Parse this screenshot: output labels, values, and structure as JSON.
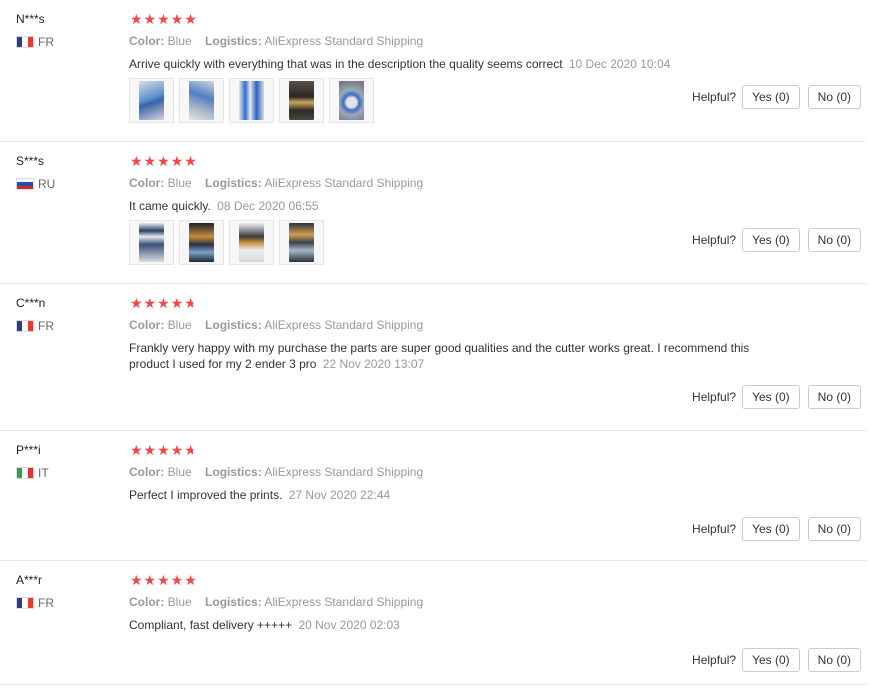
{
  "reviews": [
    {
      "user": "N***s",
      "country": "FR",
      "flag": [
        "#2f3a8f",
        "#ffffff",
        "#e53935"
      ],
      "flag_orientation": "vertical",
      "rating": 5,
      "color_label": "Color:",
      "color": "Blue",
      "logistics_label": "Logistics:",
      "logistics": "AliExpress Standard Shipping",
      "text": "Arrive quickly with everything that was in the description the quality seems correct",
      "date": "10 Dec 2020 10:04",
      "images": [
        "photo-blue-cable-coil",
        "photo-blue-cable-bag",
        "photo-blue-tubing-pair",
        "photo-hotend-parts",
        "photo-blue-cable-roll"
      ],
      "helpful_label": "Helpful?",
      "yes_label": "Yes (0)",
      "no_label": "No (0)"
    },
    {
      "user": "S***s",
      "country": "RU",
      "flag": [
        "#ffffff",
        "#1e50b4",
        "#d52b1e"
      ],
      "flag_orientation": "horizontal",
      "rating": 5,
      "color_label": "Color:",
      "color": "Blue",
      "logistics_label": "Logistics:",
      "logistics": "AliExpress Standard Shipping",
      "text": "It came quickly.",
      "date": "08 Dec 2020 06:55",
      "images": [
        "photo-parts-on-white",
        "photo-nozzles-dark",
        "photo-nozzles-light",
        "photo-fittings-dark"
      ],
      "helpful_label": "Helpful?",
      "yes_label": "Yes (0)",
      "no_label": "No (0)"
    },
    {
      "user": "C***n",
      "country": "FR",
      "flag": [
        "#2f3a8f",
        "#ffffff",
        "#e53935"
      ],
      "flag_orientation": "vertical",
      "rating": 4.5,
      "color_label": "Color:",
      "color": "Blue",
      "logistics_label": "Logistics:",
      "logistics": "AliExpress Standard Shipping",
      "text": "Frankly very happy with my purchase the parts are super good qualities and the cutter works great. I recommend this product I used for my 2 ender 3 pro",
      "date": "22 Nov 2020 13:07",
      "images": [],
      "helpful_label": "Helpful?",
      "yes_label": "Yes (0)",
      "no_label": "No (0)"
    },
    {
      "user": "P***i",
      "country": "IT",
      "flag": [
        "#2e9e4f",
        "#ffffff",
        "#d9343a"
      ],
      "flag_orientation": "vertical",
      "rating": 4.5,
      "color_label": "Color:",
      "color": "Blue",
      "logistics_label": "Logistics:",
      "logistics": "AliExpress Standard Shipping",
      "text": "Perfect I improved the prints.",
      "date": "27 Nov 2020 22:44",
      "images": [],
      "helpful_label": "Helpful?",
      "yes_label": "Yes (0)",
      "no_label": "No (0)"
    },
    {
      "user": "A***r",
      "country": "FR",
      "flag": [
        "#2f3a8f",
        "#ffffff",
        "#e53935"
      ],
      "flag_orientation": "vertical",
      "rating": 5,
      "color_label": "Color:",
      "color": "Blue",
      "logistics_label": "Logistics:",
      "logistics": "AliExpress Standard Shipping",
      "text": "Compliant, fast delivery +++++",
      "date": "20 Nov 2020 02:03",
      "images": [],
      "helpful_label": "Helpful?",
      "yes_label": "Yes (0)",
      "no_label": "No (0)"
    }
  ],
  "colors": {
    "star": "#f04848",
    "muted_text": "#999999",
    "divider": "#e8e8e8"
  }
}
